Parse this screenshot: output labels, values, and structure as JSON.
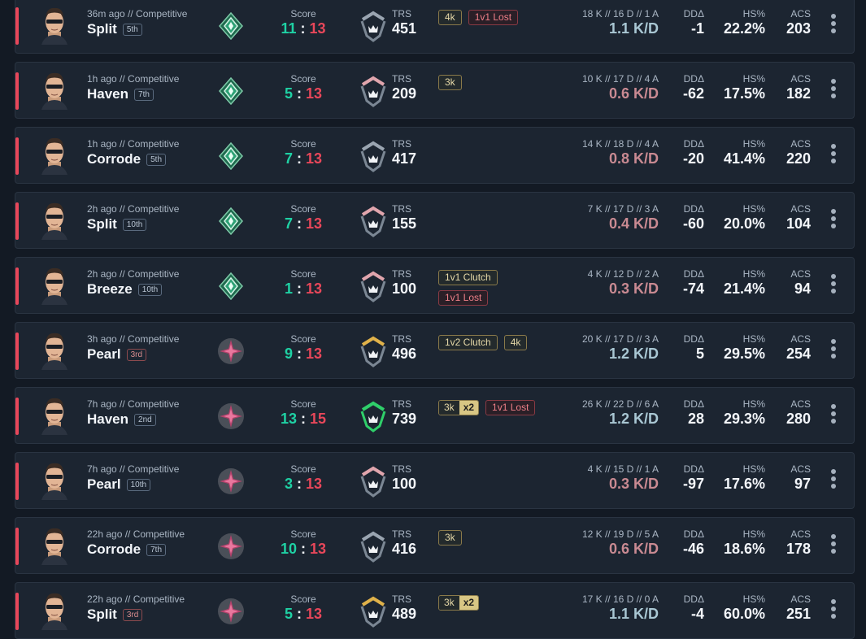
{
  "labels": {
    "score": "Score",
    "trs": "TRS",
    "ddelta": "DDΔ",
    "hs": "HS%",
    "acs": "ACS"
  },
  "colors": {
    "win_score": "#1fd1a4",
    "loss_score": "#e8475a",
    "panel": "#1c2531",
    "background": "#131a24"
  },
  "icons": {
    "agent": "agent-portrait-icon",
    "rank_emerald": "emerald-rank-icon",
    "rank_crimson": "crimson-rank-icon",
    "trs": "trs-tier-icon",
    "menu": "more-vertical-icon"
  },
  "matches": [
    {
      "time": "36m ago // Competitive",
      "map": "Split",
      "place": "5th",
      "place_color": "blue",
      "rank": "emerald",
      "team_score": "11",
      "enemy_score": "13",
      "trs_tier": "grey",
      "trs": "451",
      "badges": [
        [
          "4k",
          "1v1 Lost"
        ]
      ],
      "kda": "18 K // 16 D // 1 A",
      "kd": "1.1 K/D",
      "kd_good": true,
      "dd": "-1",
      "hs": "22.2%",
      "acs": "203"
    },
    {
      "time": "1h ago // Competitive",
      "map": "Haven",
      "place": "7th",
      "place_color": "blue",
      "rank": "emerald",
      "team_score": "5",
      "enemy_score": "13",
      "trs_tier": "pink",
      "trs": "209",
      "badges": [
        [
          "3k"
        ]
      ],
      "kda": "10 K // 17 D // 4 A",
      "kd": "0.6 K/D",
      "kd_good": false,
      "dd": "-62",
      "hs": "17.5%",
      "acs": "182"
    },
    {
      "time": "1h ago // Competitive",
      "map": "Corrode",
      "place": "5th",
      "place_color": "blue",
      "rank": "emerald",
      "team_score": "7",
      "enemy_score": "13",
      "trs_tier": "grey",
      "trs": "417",
      "badges": [],
      "kda": "14 K // 18 D // 4 A",
      "kd": "0.8 K/D",
      "kd_good": false,
      "dd": "-20",
      "hs": "41.4%",
      "acs": "220"
    },
    {
      "time": "2h ago // Competitive",
      "map": "Split",
      "place": "10th",
      "place_color": "blue",
      "rank": "emerald",
      "team_score": "7",
      "enemy_score": "13",
      "trs_tier": "pink",
      "trs": "155",
      "badges": [],
      "kda": "7 K // 17 D // 3 A",
      "kd": "0.4 K/D",
      "kd_good": false,
      "dd": "-60",
      "hs": "20.0%",
      "acs": "104"
    },
    {
      "time": "2h ago // Competitive",
      "map": "Breeze",
      "place": "10th",
      "place_color": "blue",
      "rank": "emerald",
      "team_score": "1",
      "enemy_score": "13",
      "trs_tier": "pink",
      "trs": "100",
      "badges": [
        [
          "1v1 Clutch"
        ],
        [
          "1v1 Lost"
        ]
      ],
      "kda": "4 K // 12 D // 2 A",
      "kd": "0.3 K/D",
      "kd_good": false,
      "dd": "-74",
      "hs": "21.4%",
      "acs": "94"
    },
    {
      "time": "3h ago // Competitive",
      "map": "Pearl",
      "place": "3rd",
      "place_color": "red",
      "rank": "crimson",
      "team_score": "9",
      "enemy_score": "13",
      "trs_tier": "gold",
      "trs": "496",
      "badges": [
        [
          "1v2 Clutch",
          "4k"
        ]
      ],
      "kda": "20 K // 17 D // 3 A",
      "kd": "1.2 K/D",
      "kd_good": true,
      "dd": "5",
      "hs": "29.5%",
      "acs": "254"
    },
    {
      "time": "7h ago // Competitive",
      "map": "Haven",
      "place": "2nd",
      "place_color": "blue",
      "rank": "crimson",
      "team_score": "13",
      "enemy_score": "15",
      "trs_tier": "green",
      "trs": "739",
      "badges": [
        [
          "3k|x2",
          "1v1 Lost"
        ]
      ],
      "kda": "26 K // 22 D // 6 A",
      "kd": "1.2 K/D",
      "kd_good": true,
      "dd": "28",
      "hs": "29.3%",
      "acs": "280"
    },
    {
      "time": "7h ago // Competitive",
      "map": "Pearl",
      "place": "10th",
      "place_color": "blue",
      "rank": "crimson",
      "team_score": "3",
      "enemy_score": "13",
      "trs_tier": "pink",
      "trs": "100",
      "badges": [],
      "kda": "4 K // 15 D // 1 A",
      "kd": "0.3 K/D",
      "kd_good": false,
      "dd": "-97",
      "hs": "17.6%",
      "acs": "97"
    },
    {
      "time": "22h ago // Competitive",
      "map": "Corrode",
      "place": "7th",
      "place_color": "blue",
      "rank": "crimson",
      "team_score": "10",
      "enemy_score": "13",
      "trs_tier": "grey",
      "trs": "416",
      "badges": [
        [
          "3k"
        ]
      ],
      "kda": "12 K // 19 D // 5 A",
      "kd": "0.6 K/D",
      "kd_good": false,
      "dd": "-46",
      "hs": "18.6%",
      "acs": "178"
    },
    {
      "time": "22h ago // Competitive",
      "map": "Split",
      "place": "3rd",
      "place_color": "red",
      "rank": "crimson",
      "team_score": "5",
      "enemy_score": "13",
      "trs_tier": "gold",
      "trs": "489",
      "badges": [
        [
          "3k|x2"
        ]
      ],
      "kda": "17 K // 16 D // 0 A",
      "kd": "1.1 K/D",
      "kd_good": true,
      "dd": "-4",
      "hs": "60.0%",
      "acs": "251"
    }
  ]
}
